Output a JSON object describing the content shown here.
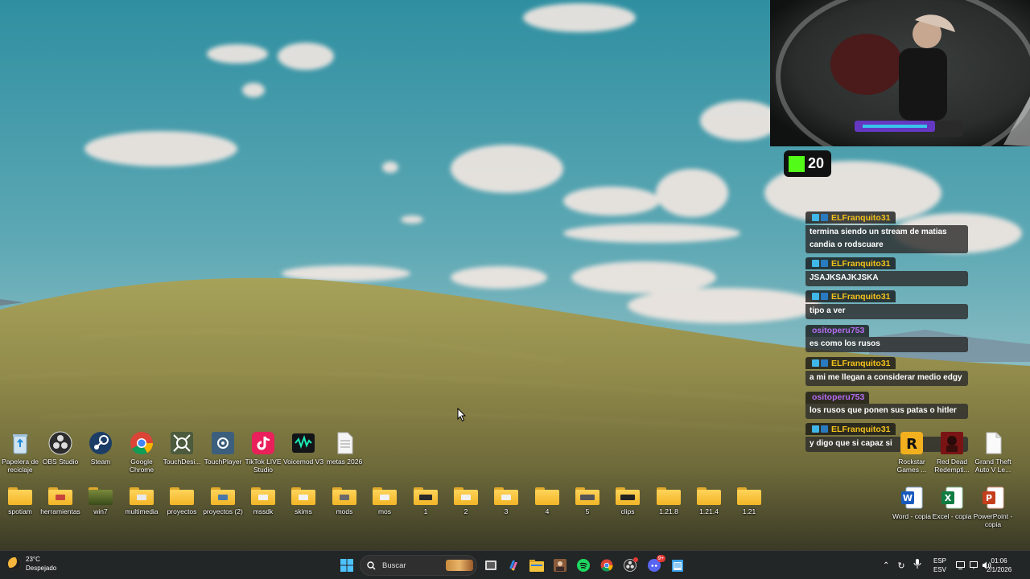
{
  "desktop": {
    "row1": [
      {
        "name": "recycle-bin-icon",
        "label": "Papelera de reciclaje"
      },
      {
        "name": "obs-studio-icon",
        "label": "OBS Studio"
      },
      {
        "name": "steam-icon",
        "label": "Steam"
      },
      {
        "name": "google-chrome-icon",
        "label": "Google Chrome"
      },
      {
        "name": "touchdesigner-icon",
        "label": "TouchDesi..."
      },
      {
        "name": "touchplayer-icon",
        "label": "TouchPlayer"
      },
      {
        "name": "tiktok-live-studio-icon",
        "label": "TikTok LIVE Studio"
      },
      {
        "name": "voicemod-icon",
        "label": "Voicemod V3"
      },
      {
        "name": "text-file-icon",
        "label": "metas 2026"
      }
    ],
    "row2": [
      {
        "label": "spotiam"
      },
      {
        "label": "herramientas"
      },
      {
        "label": "win7"
      },
      {
        "label": "multimedia"
      },
      {
        "label": "proyectos"
      },
      {
        "label": "proyectos (2)"
      },
      {
        "label": "mssdk"
      },
      {
        "label": "skims"
      },
      {
        "label": "mods"
      },
      {
        "label": "mos"
      },
      {
        "label": "1"
      },
      {
        "label": "2"
      },
      {
        "label": "3"
      },
      {
        "label": "4"
      },
      {
        "label": "5"
      },
      {
        "label": "clips"
      },
      {
        "label": "1.21.8"
      },
      {
        "label": "1.21.4"
      },
      {
        "label": "1.21"
      }
    ],
    "right_row1": [
      {
        "name": "rockstar-games-icon",
        "label": "Rockstar Games ..."
      },
      {
        "name": "red-dead-redemption-icon",
        "label": "Red Dead Redempti..."
      },
      {
        "name": "gta-file-icon",
        "label": "Grand Theft Auto V Le..."
      }
    ],
    "right_row2": [
      {
        "name": "word-icon",
        "label": "Word - copia"
      },
      {
        "name": "excel-icon",
        "label": "Excel - copia"
      },
      {
        "name": "powerpoint-icon",
        "label": "PowerPoint - copia"
      }
    ]
  },
  "kick": {
    "count": "20",
    "brand_color": "#53fc18"
  },
  "chat": [
    {
      "user": "ELFranquito31",
      "color": "#f4c21b",
      "text": "termina siendo un stream de matias candia o rodscuare"
    },
    {
      "user": "ELFranquito31",
      "color": "#f4c21b",
      "text": "JSAJKSAJKJSKA"
    },
    {
      "user": "ELFranquito31",
      "color": "#f4c21b",
      "text": "tipo a ver"
    },
    {
      "user": "ositoperu753",
      "color": "#b46cf0",
      "text": "es como los rusos"
    },
    {
      "user": "ELFranquito31",
      "color": "#f4c21b",
      "text": "a mi me llegan a considerar medio edgy"
    },
    {
      "user": "ositoperu753",
      "color": "#b46cf0",
      "text": "los rusos que ponen sus patas o hitler"
    },
    {
      "user": "ELFranquito31",
      "color": "#f4c21b",
      "text": "y digo que si capaz si"
    }
  ],
  "taskbar": {
    "weather_temp": "23°C",
    "weather_desc": "Despejado",
    "search_placeholder": "Buscar",
    "apps": [
      "windows-start-icon",
      "task-view-icon",
      "copilot-icon",
      "file-explorer-icon",
      "photo-app-icon",
      "spotify-icon",
      "chrome-icon",
      "obs-icon",
      "discord-icon",
      "notepad-icon"
    ],
    "discord_badge": "9+",
    "lang_line1": "ESP",
    "lang_line2": "ESV",
    "time": "01:06",
    "date": "2/1/2026"
  }
}
